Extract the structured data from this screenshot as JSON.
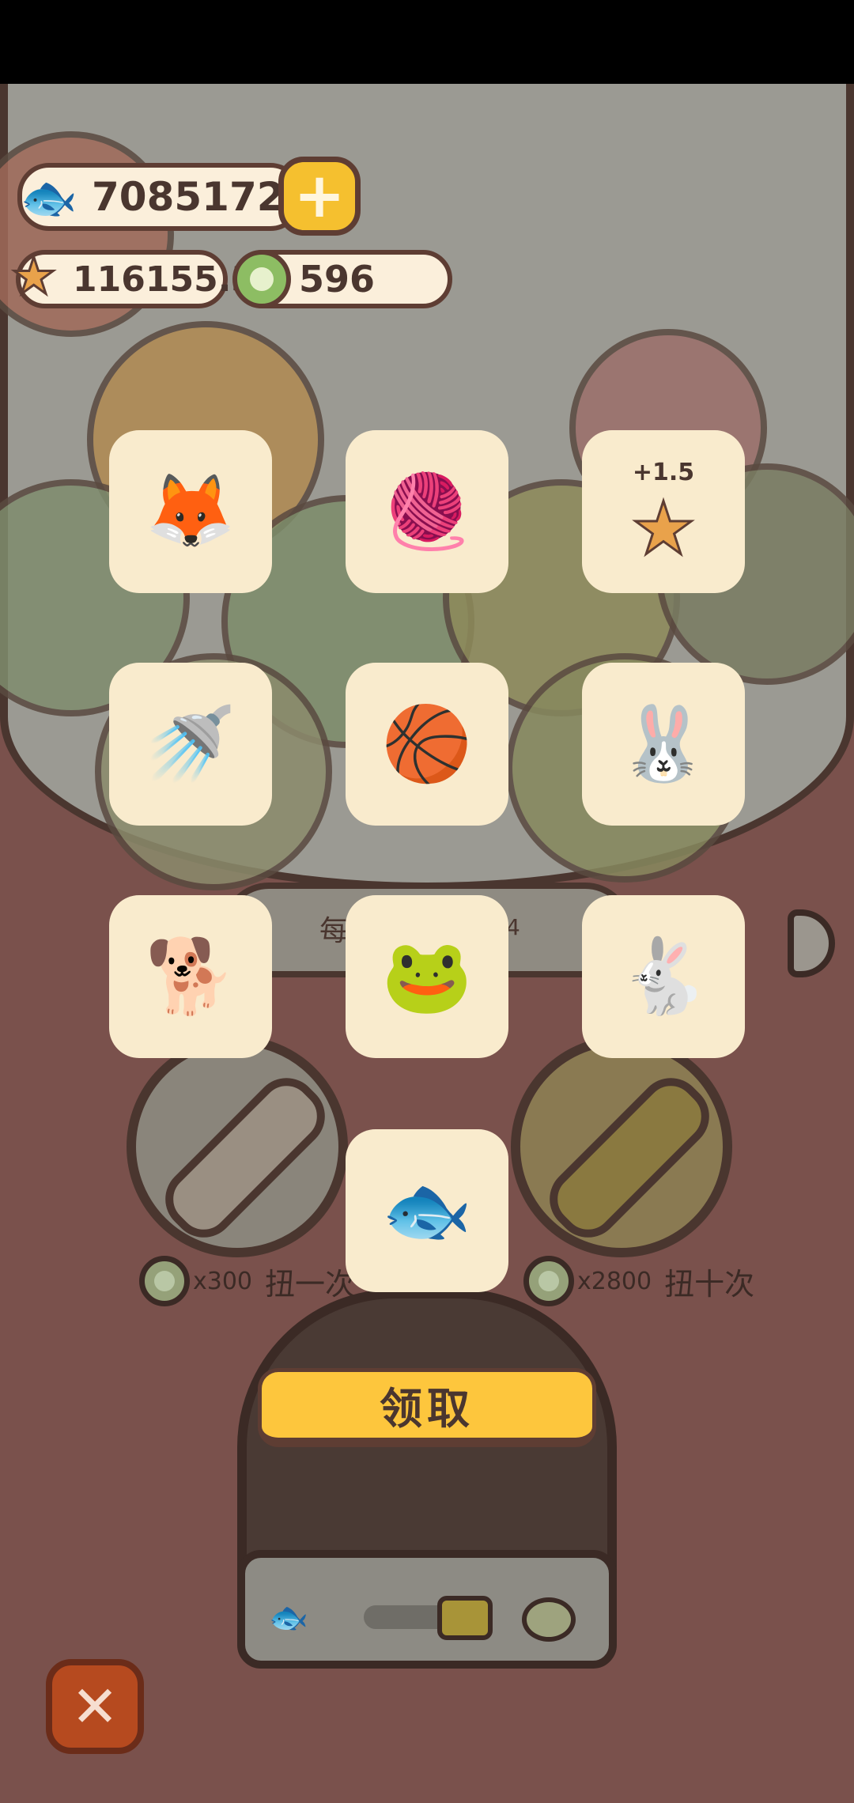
{
  "currencies": {
    "fish": "7085172",
    "stars": "116155.3",
    "gems": "596"
  },
  "rewards": [
    {
      "name": "fox-mechanic-figure",
      "glyph": "🦊",
      "bonus": ""
    },
    {
      "name": "yarn-balls",
      "glyph": "🧶",
      "bonus": ""
    },
    {
      "name": "star-bonus",
      "glyph": "★",
      "bonus": "+1.5"
    },
    {
      "name": "watering-can",
      "glyph": "🚿",
      "bonus": ""
    },
    {
      "name": "brown-ball",
      "glyph": "🏀",
      "bonus": ""
    },
    {
      "name": "bunny-hood-cat",
      "glyph": "🐰",
      "bonus": ""
    },
    {
      "name": "shiba-reading",
      "glyph": "🐕",
      "bonus": ""
    },
    {
      "name": "frog-face",
      "glyph": "🐸",
      "bonus": ""
    },
    {
      "name": "bunny-with-orb",
      "glyph": "🐇",
      "bonus": ""
    },
    {
      "name": "purple-fish",
      "glyph": "🐟",
      "bonus": ""
    }
  ],
  "background": {
    "hint_prefix": "每",
    "hint_suffix": "4"
  },
  "spin_one": {
    "cost": "x300",
    "label": "扭一次"
  },
  "spin_ten": {
    "cost": "x2800",
    "label": "扭十次"
  },
  "claim_label": "领取",
  "close_symbol": "✕",
  "add_symbol": "+",
  "icons": {
    "fish": "fish-icon",
    "star": "star-icon",
    "gem": "gem-icon"
  }
}
